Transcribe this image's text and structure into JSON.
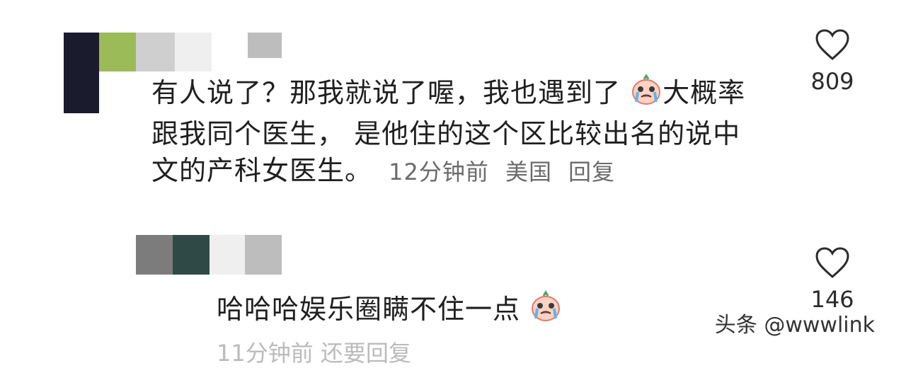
{
  "comments": [
    {
      "text_lines": [
        "有人说了？那我就说了喔，我也遇到了",
        "大概率",
        "跟我同个医生， 是他住的这个区比较出名的说中",
        "文的产科女医生。"
      ],
      "meta": [
        "12分钟前",
        "美国",
        "回复"
      ],
      "likes": "809",
      "emoji": "crying-face-emoji"
    },
    {
      "text": "哈哈哈娱乐圈瞒不住一点",
      "meta_partial": "11分钟前  还要回复",
      "likes": "146",
      "emoji": "crying-face-emoji"
    }
  ],
  "watermark": "头条 @wwwlink",
  "colors": {
    "heart_outline": "#2b2b2b",
    "avatar_dark": "#1b1b2e",
    "avatar_green": "#9bbb59"
  }
}
